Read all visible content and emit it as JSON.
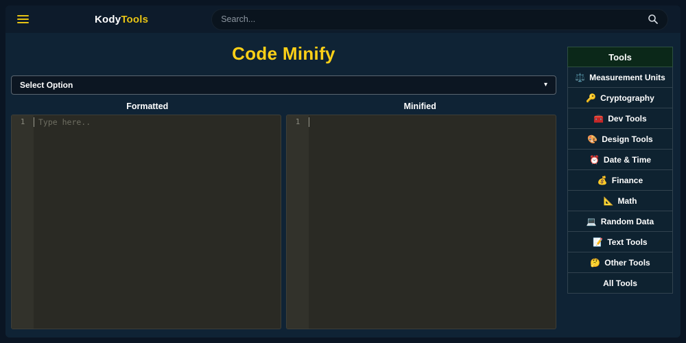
{
  "navbar": {
    "logo": {
      "part1": "Kody",
      "part2": "Tools"
    },
    "search": {
      "placeholder": "Search..."
    }
  },
  "page": {
    "title": "Code Minify"
  },
  "select": {
    "value": "Select Option",
    "caret": "▾"
  },
  "editors": [
    {
      "label": "Formatted",
      "line_number": "1",
      "placeholder": "Type here.."
    },
    {
      "label": "Minified",
      "line_number": "1",
      "placeholder": ""
    }
  ],
  "sidebar": {
    "header": "Tools",
    "items": [
      {
        "icon": "⚖️",
        "label": "Measurement Units"
      },
      {
        "icon": "🔑",
        "label": "Cryptography"
      },
      {
        "icon": "🧰",
        "label": "Dev Tools"
      },
      {
        "icon": "🎨",
        "label": "Design Tools"
      },
      {
        "icon": "⏰",
        "label": "Date & Time"
      },
      {
        "icon": "💰",
        "label": "Finance"
      },
      {
        "icon": "📐",
        "label": "Math"
      },
      {
        "icon": "💻",
        "label": "Random Data"
      },
      {
        "icon": "📝",
        "label": "Text Tools"
      },
      {
        "icon": "🤔",
        "label": "Other Tools"
      },
      {
        "icon": "",
        "label": "All Tools"
      }
    ]
  },
  "colors": {
    "accent_yellow": "#e8c414",
    "title_yellow": "#fdd017",
    "body_bg": "#0f2335",
    "navbar_bg": "#0d1b2b",
    "editor_bg": "#2a2a24",
    "sidebar_header_bg": "#0b2819"
  }
}
